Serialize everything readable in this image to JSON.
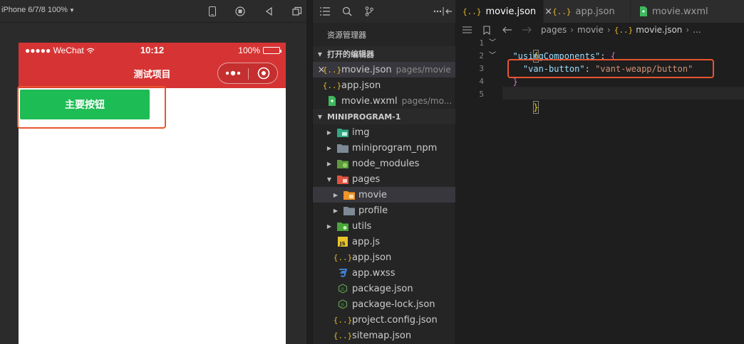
{
  "simulator": {
    "device_label": "iPhone 6/7/8 100%",
    "status_bar": {
      "carrier": "●●●●● WeChat",
      "time": "10:12",
      "battery": "100%"
    },
    "nav_title": "测试项目",
    "primary_button": "主要按钮",
    "colors": {
      "header": "#d63434",
      "button": "#1ebc55",
      "highlight": "#e8552f"
    },
    "toolbar_icons": [
      "phone-icon",
      "record-icon",
      "volume-icon",
      "window-icon"
    ]
  },
  "explorer": {
    "title": "资源管理器",
    "open_editors_header": "打开的编辑器",
    "open_editors": [
      {
        "name": "movie.json",
        "desc": "pages/movie",
        "icon": "json-icon",
        "active": true
      },
      {
        "name": "app.json",
        "desc": "",
        "icon": "json-icon",
        "active": false
      },
      {
        "name": "movie.wxml",
        "desc": "pages/mo...",
        "icon": "wxml-icon",
        "active": false
      }
    ],
    "project_header": "MINIPROGRAM-1",
    "tree": [
      {
        "name": "img",
        "type": "folder",
        "icon": "image-folder-icon"
      },
      {
        "name": "miniprogram_npm",
        "type": "folder",
        "icon": "folder-icon"
      },
      {
        "name": "node_modules",
        "type": "folder",
        "icon": "node-folder-icon"
      },
      {
        "name": "pages",
        "type": "folder-open",
        "icon": "pages-folder-icon"
      },
      {
        "name": "movie",
        "type": "subfolder-selected",
        "icon": "folder-orange-icon"
      },
      {
        "name": "profile",
        "type": "subfolder",
        "icon": "folder-icon"
      },
      {
        "name": "utils",
        "type": "folder",
        "icon": "utils-folder-icon"
      },
      {
        "name": "app.js",
        "type": "file",
        "icon": "js-icon"
      },
      {
        "name": "app.json",
        "type": "file",
        "icon": "json-icon"
      },
      {
        "name": "app.wxss",
        "type": "file",
        "icon": "css-icon"
      },
      {
        "name": "package.json",
        "type": "file",
        "icon": "node-file-icon"
      },
      {
        "name": "package-lock.json",
        "type": "file",
        "icon": "node-file-icon"
      },
      {
        "name": "project.config.json",
        "type": "file",
        "icon": "json-icon"
      },
      {
        "name": "sitemap.json",
        "type": "file",
        "icon": "json-icon"
      }
    ]
  },
  "editor": {
    "tabs": [
      {
        "name": "movie.json",
        "active": true,
        "icon": "json-icon"
      },
      {
        "name": "app.json",
        "active": false,
        "icon": "json-icon"
      },
      {
        "name": "movie.wxml",
        "active": false,
        "icon": "wxml-icon"
      }
    ],
    "breadcrumb": [
      "pages",
      "movie",
      "movie.json",
      "..."
    ],
    "line_numbers": [
      "1",
      "2",
      "3",
      "4",
      "5"
    ],
    "code": {
      "l1": "{",
      "l2_key": "\"usingComponents\"",
      "l2_colon": ": ",
      "l2_brace": "{",
      "l3_key": "\"van-button\"",
      "l3_colon": ": ",
      "l3_val": "\"vant-weapp/button\"",
      "l4": "}",
      "l5": "}"
    }
  }
}
